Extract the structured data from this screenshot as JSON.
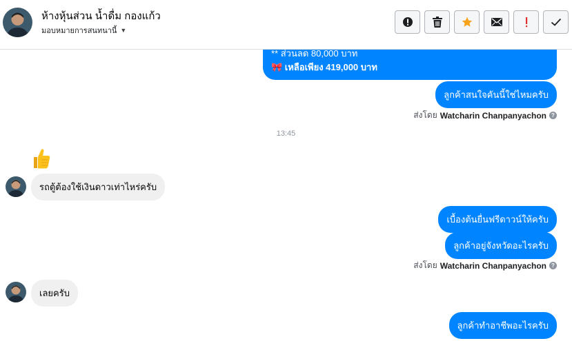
{
  "header": {
    "name": "ห้างหุ้นส่วน น้ำดื่ม กองแก้ว",
    "assign_label": "มอบหมายการสนทนานี้"
  },
  "toolbar": {
    "buttons": [
      {
        "icon": "alert-circle-icon"
      },
      {
        "icon": "trash-icon"
      },
      {
        "icon": "star-icon"
      },
      {
        "icon": "envelope-icon"
      },
      {
        "icon": "exclamation-icon"
      },
      {
        "icon": "check-icon"
      }
    ]
  },
  "messages": {
    "offer_line1": "** ส่วนลด 80,000 บาท",
    "offer_line2": "🎀 เหลือเพียง 419,000 บาท",
    "msg_interest": "ลูกค้าสนใจคันนี้ใช่ไหมครับ",
    "sent_by_prefix": "ส่งโดย",
    "sent_by_name": "Watcharin Chanpanyachon",
    "timestamp": "13:45",
    "msg_in_price": "รถตู้ต้องใช้เงินดาวเท่าไหร่ครับ",
    "msg_down": "เบื้องต้นยื่นฟรีดาวน์ให้ครับ",
    "msg_province": "ลูกค้าอยู่จังหวัดอะไรครับ",
    "sent_by_prefix_2": "ส่งโดย",
    "sent_by_name_2": "Watcharin Chanpanyachon",
    "msg_in_ok": "เลยครับ",
    "msg_job": "ลูกค้าทำอาชีพอะไรครับ"
  },
  "colors": {
    "accent": "#0084ff",
    "incoming_bubble": "#f0f0f0",
    "star": "#f7a21b",
    "danger": "#e02d2d"
  }
}
